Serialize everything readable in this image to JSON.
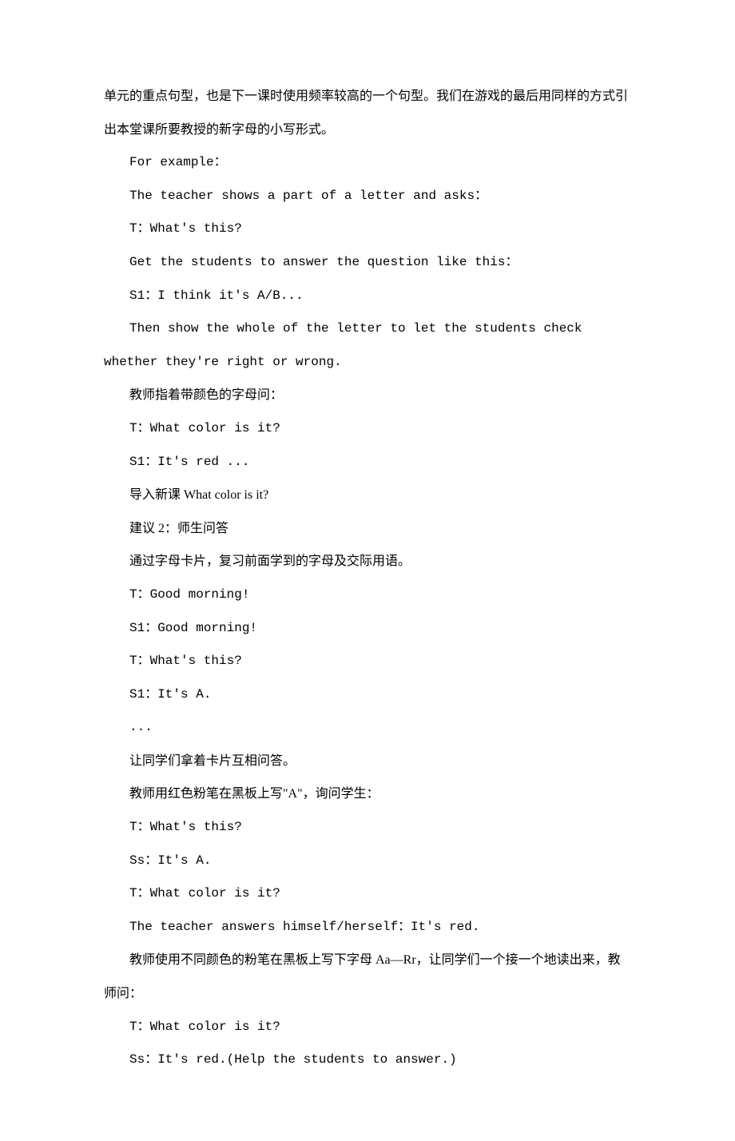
{
  "lines": [
    {
      "text": "单元的重点句型，也是下一课时使用频率较高的一个句型。我们在游戏的最后用同样的方式引出本堂课所要教授的新字母的小写形式。",
      "indent": false,
      "mono": false
    },
    {
      "text": "For example：",
      "indent": true,
      "mono": true
    },
    {
      "text": "The teacher shows a part of a letter and asks：",
      "indent": true,
      "mono": true
    },
    {
      "text": "T：What's this?",
      "indent": true,
      "mono": true
    },
    {
      "text": "Get the students to answer the question like this：",
      "indent": true,
      "mono": true
    },
    {
      "text": "S1：I think it's A/B...",
      "indent": true,
      "mono": true
    },
    {
      "text": "Then show the whole of the letter to let the students check whether they're right or wrong.",
      "indent": true,
      "mono": true
    },
    {
      "text": "教师指着带颜色的字母问：",
      "indent": true,
      "mono": false
    },
    {
      "text": "T：What color is it?",
      "indent": true,
      "mono": true
    },
    {
      "text": "S1：It's red ...",
      "indent": true,
      "mono": true
    },
    {
      "text": "导入新课 What color is it?",
      "indent": true,
      "mono": false
    },
    {
      "text": "建议 2：师生问答",
      "indent": true,
      "mono": false
    },
    {
      "text": "通过字母卡片，复习前面学到的字母及交际用语。",
      "indent": true,
      "mono": false
    },
    {
      "text": "T：Good morning!",
      "indent": true,
      "mono": true
    },
    {
      "text": "S1：Good morning!",
      "indent": true,
      "mono": true
    },
    {
      "text": "T：What's this?",
      "indent": true,
      "mono": true
    },
    {
      "text": "S1：It's A.",
      "indent": true,
      "mono": true
    },
    {
      "text": "...",
      "indent": true,
      "mono": true
    },
    {
      "text": "让同学们拿着卡片互相问答。",
      "indent": true,
      "mono": false
    },
    {
      "text": "教师用红色粉笔在黑板上写\"A\"，询问学生：",
      "indent": true,
      "mono": false
    },
    {
      "text": "T：What's this?",
      "indent": true,
      "mono": true
    },
    {
      "text": "Ss：It's A.",
      "indent": true,
      "mono": true
    },
    {
      "text": "T：What color is it?",
      "indent": true,
      "mono": true
    },
    {
      "text": "The teacher answers himself/herself：It's red.",
      "indent": true,
      "mono": true
    },
    {
      "text": "  教师使用不同颜色的粉笔在黑板上写下字母 Aa—Rr，让同学们一个接一个地读出来，教师问：",
      "indent": true,
      "mono": false
    },
    {
      "text": "T：What color is it?",
      "indent": true,
      "mono": true
    },
    {
      "text": "Ss：It's red.(Help the students to answer.)",
      "indent": true,
      "mono": true
    }
  ]
}
